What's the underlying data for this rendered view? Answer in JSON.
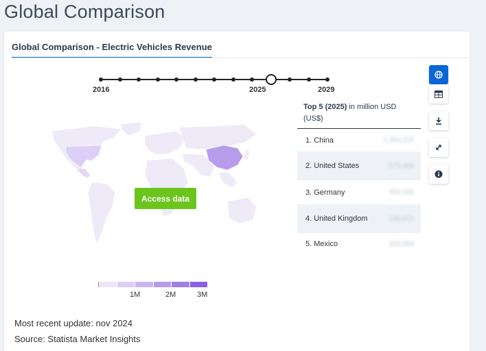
{
  "page": {
    "title": "Global Comparison"
  },
  "card": {
    "tab_label": "Global Comparison - Electric Vehicles Revenue"
  },
  "timeline": {
    "start_label": "2016",
    "current_label": "2025",
    "end_label": "2029",
    "points": 13,
    "current_index": 9
  },
  "map": {
    "access_button_label": "Access data"
  },
  "legend": {
    "labels": [
      "1M",
      "2M",
      "3M"
    ],
    "colors": [
      "#ece5fb",
      "#dccff7",
      "#c9b6f1",
      "#b79cec",
      "#a27fe5",
      "#8c62de"
    ]
  },
  "footer": {
    "update": "Most recent update: nov 2024",
    "source": "Source: Statista Market Insights"
  },
  "top5": {
    "title_bold": "Top 5 (2025)",
    "title_rest": " in million USD (US$)",
    "rows": [
      {
        "rank_name": "1. China",
        "value": "2,394,225"
      },
      {
        "rank_name": "2. United States",
        "value": "575,466"
      },
      {
        "rank_name": "3. Germany",
        "value": "350,332"
      },
      {
        "rank_name": "4. United Kingdom",
        "value": "246,672"
      },
      {
        "rank_name": "5. Mexico",
        "value": "255,884"
      }
    ]
  },
  "tools": [
    "globe-icon",
    "table-icon",
    "download-icon",
    "expand-icon",
    "info-icon"
  ],
  "colors": {
    "accent": "#0a66d8",
    "button_green": "#6cc51d",
    "china": "#b79cec",
    "light_country": "#eeeaf8"
  }
}
